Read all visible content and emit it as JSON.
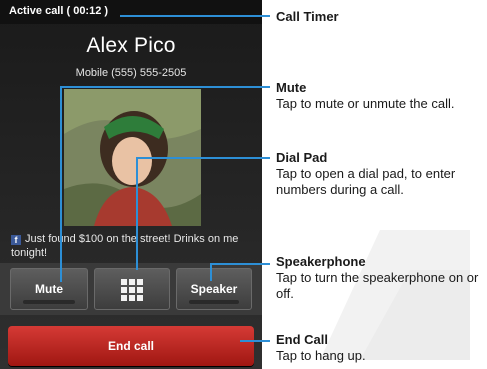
{
  "call": {
    "timer": "Active call ( 00:12 )",
    "contact_name": "Alex Pico",
    "contact_number": "Mobile (555) 555-2505",
    "status_update": "Just found $100 on the street! Drinks on me tonight!",
    "status_source_icon": "facebook-icon"
  },
  "buttons": {
    "mute_label": "Mute",
    "dialpad_icon": "dialpad-grid-icon",
    "speaker_label": "Speaker",
    "end_call_label": "End call"
  },
  "annotations": {
    "call_timer": {
      "title": "Call Timer",
      "desc": ""
    },
    "mute": {
      "title": "Mute",
      "desc": "Tap to mute or unmute the call."
    },
    "dial_pad": {
      "title": "Dial Pad",
      "desc": "Tap to open a dial pad, to enter numbers during a call."
    },
    "speakerphone": {
      "title": "Speakerphone",
      "desc": "Tap to turn the speakerphone on or off."
    },
    "end_call": {
      "title": "End Call",
      "desc": "Tap to hang up."
    }
  },
  "colors": {
    "callout_line": "#2d8fd6",
    "end_call": "#c0261f",
    "screen_background": "#222222"
  }
}
